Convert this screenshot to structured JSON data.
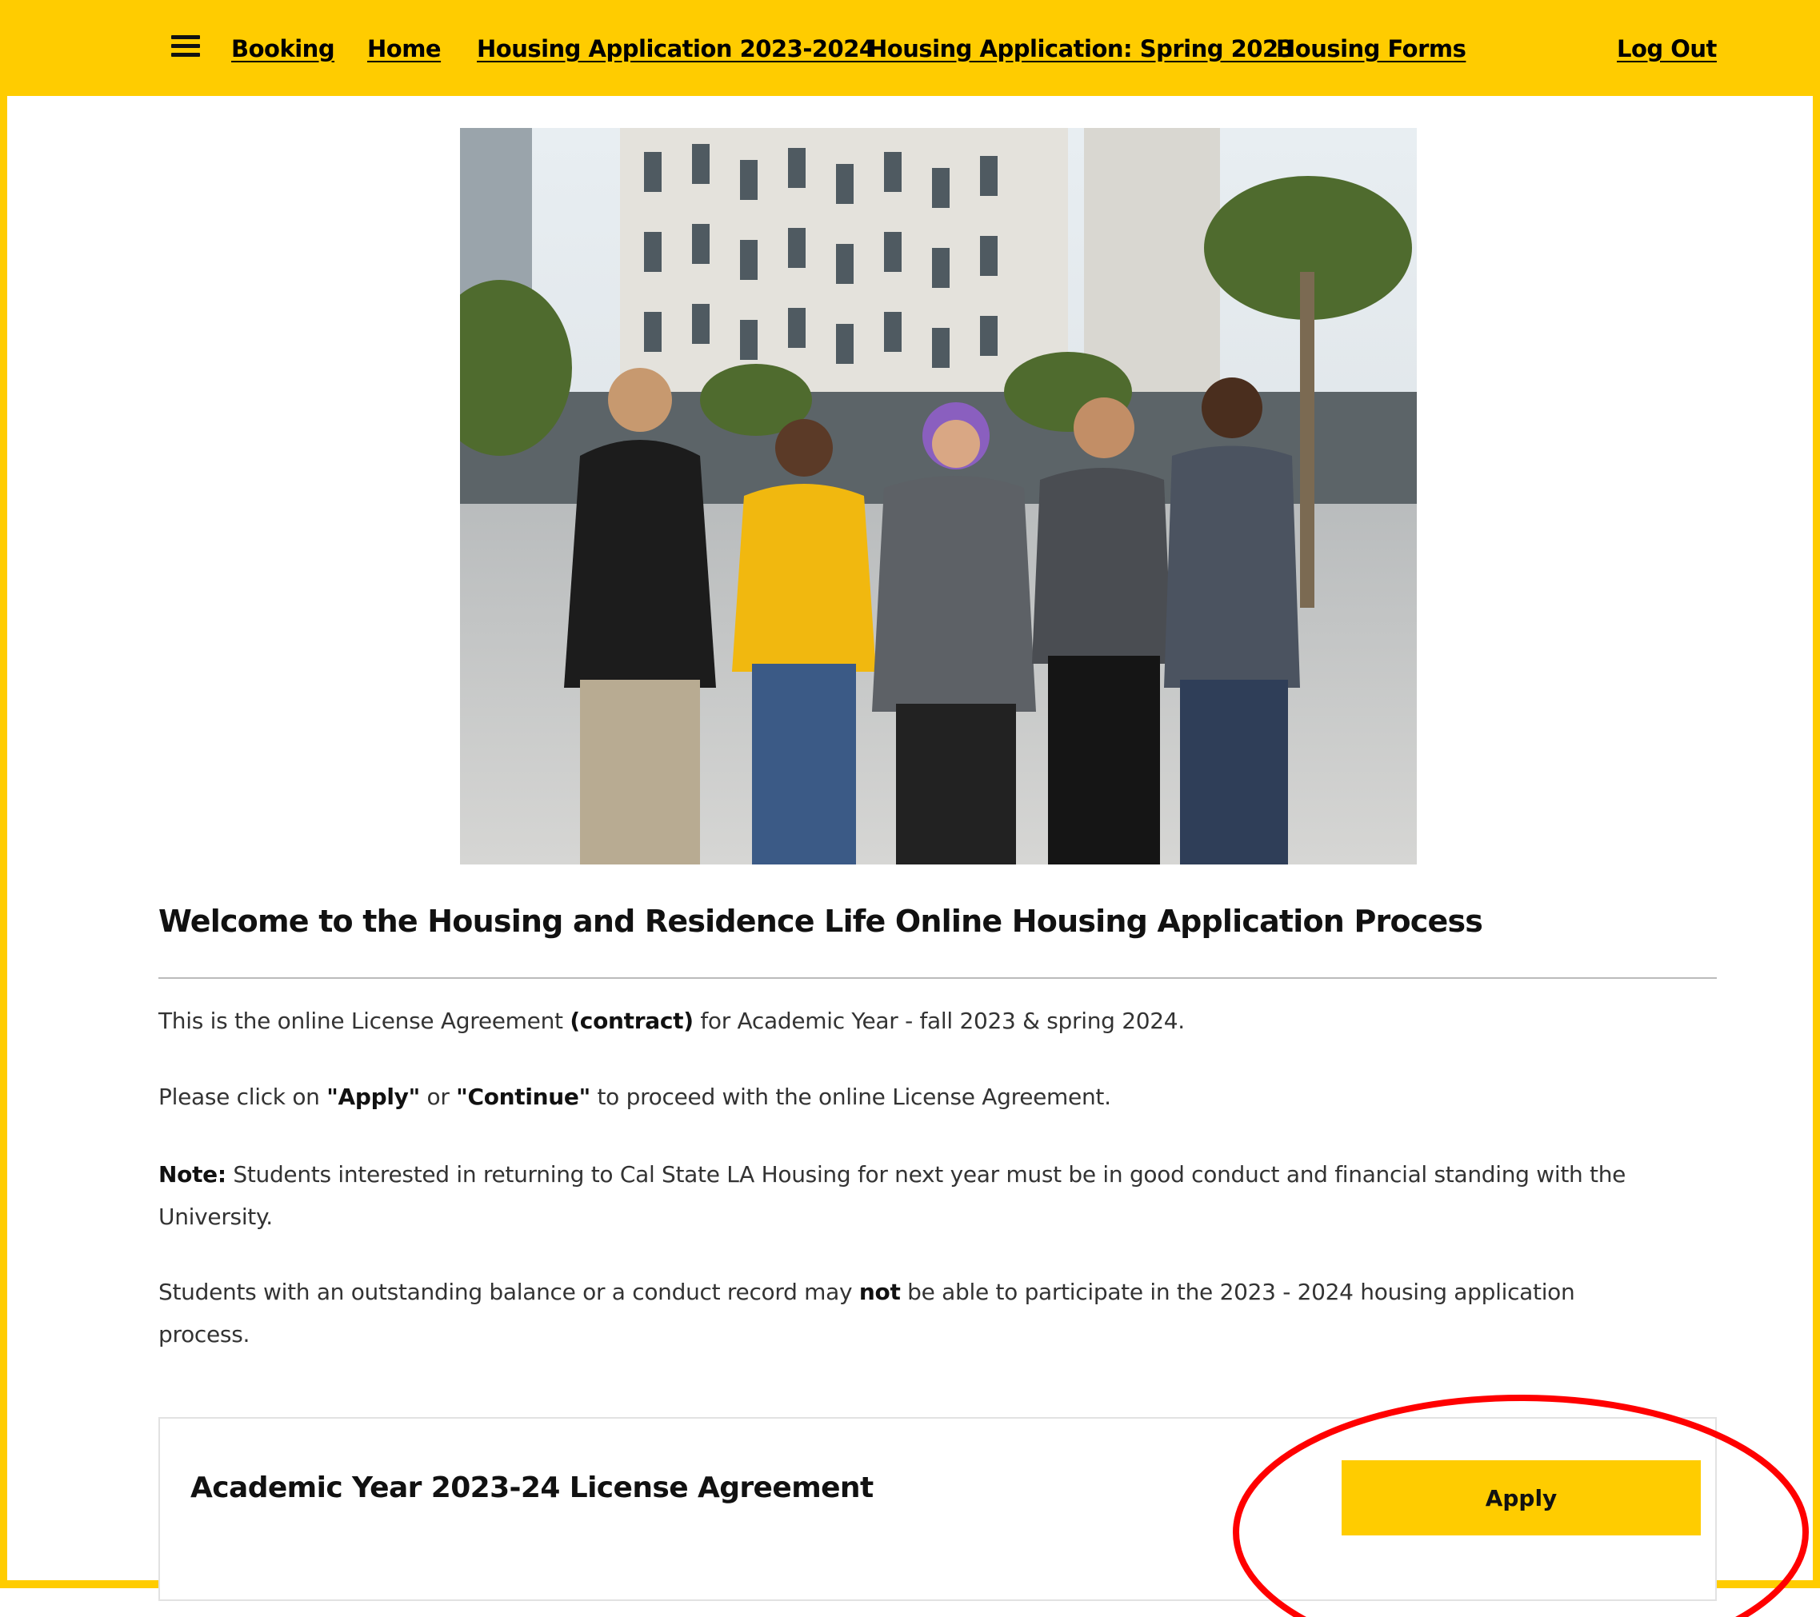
{
  "nav": {
    "menu_icon": "hamburger-menu-icon",
    "links": [
      "Booking",
      "Home",
      "Housing Application 2023-2024",
      "Housing Application: Spring 2023",
      "Housing Forms"
    ],
    "logout": "Log Out",
    "bar_color": "#FFCC00"
  },
  "hero": {
    "alt": "Five students in Cal State LA sweatshirts standing in front of a residence hall"
  },
  "welcome": {
    "title": "Welcome to the Housing and Residence Life Online Housing Application Process"
  },
  "body": {
    "p1_pre": "This is the online License Agreement ",
    "p1_bold": "(contract)",
    "p1_post": " for Academic Year - fall 2023 & spring 2024.",
    "p2_pre": "Please click on ",
    "p2_bold1": "\"Apply\"",
    "p2_mid": " or ",
    "p2_bold2": "\"Continue\"",
    "p2_post": " to proceed with the online License Agreement.",
    "p3_bold": "Note:",
    "p3_text": " Students interested in returning to Cal State LA Housing for next year must be in good conduct and financial standing with the University.",
    "p4_pre": "Students with an outstanding balance or a conduct record may ",
    "p4_bold": "not",
    "p4_post": " be able to participate in the 2023 - 2024 housing application process."
  },
  "card": {
    "title": "Academic Year 2023-24 License Agreement",
    "apply_label": "Apply",
    "button_color": "#FFCC00"
  },
  "annotation": {
    "ring_color": "#FF0000"
  }
}
